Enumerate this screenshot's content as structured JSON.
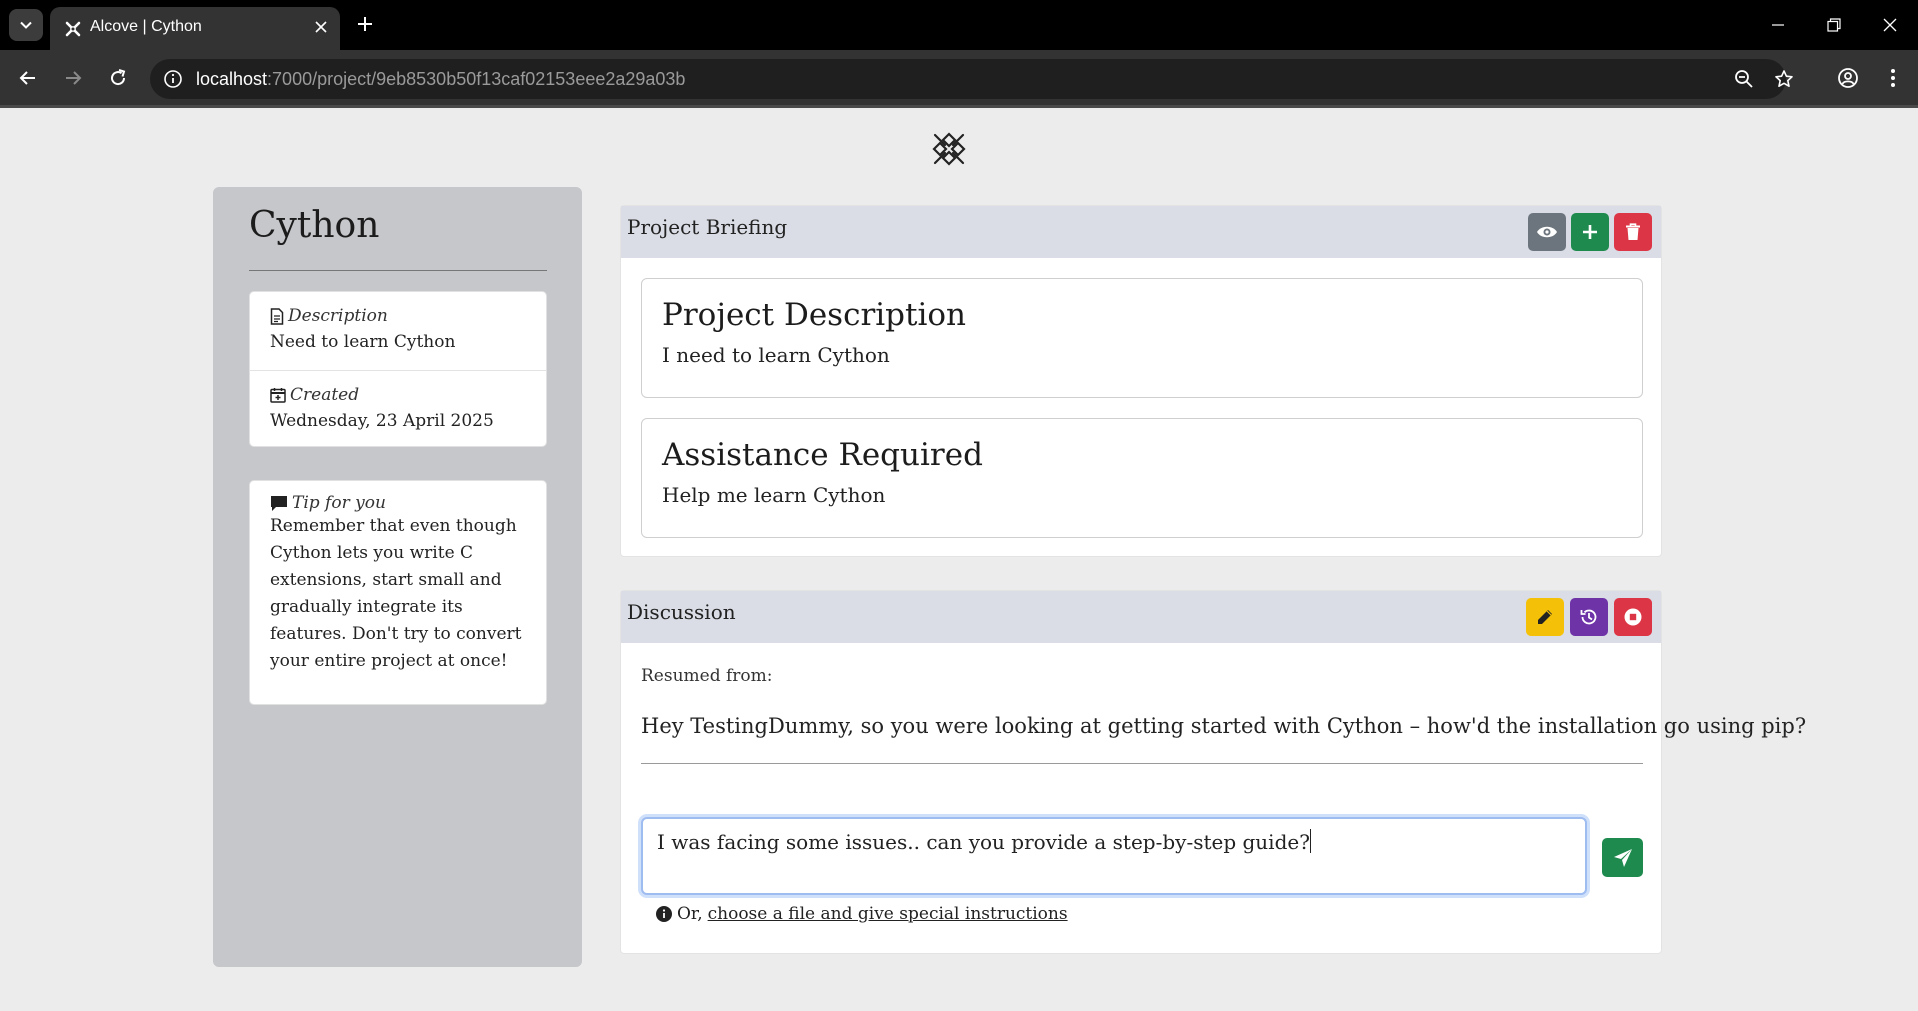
{
  "browser": {
    "tab_title": "Alcove | Cython",
    "url_host": "localhost",
    "url_path": ":7000/project/9eb8530b50f13caf02153eee2a29a03b"
  },
  "sidebar": {
    "title": "Cython",
    "description_label": "Description",
    "description_value": "Need to learn Cython",
    "created_label": "Created",
    "created_value": "Wednesday, 23 April 2025",
    "tip_label": "Tip for you",
    "tip_text": "Remember that even though Cython lets you write C extensions, start small and gradually integrate its features. Don't try to convert your entire project at once!"
  },
  "briefing": {
    "title": "Project Briefing",
    "cards": [
      {
        "title": "Project Description",
        "text": "I need to learn Cython"
      },
      {
        "title": "Assistance Required",
        "text": "Help me learn Cython"
      }
    ]
  },
  "discussion": {
    "title": "Discussion",
    "resumed_label": "Resumed from:",
    "message": "Hey TestingDummy, so you were looking at getting started with Cython – how'd the installation go using pip?",
    "input_value": "I was facing some issues.. can you provide a step-by-step guide?",
    "hint_prefix": "Or,",
    "hint_link": "choose a file and give special instructions"
  },
  "colors": {
    "view_button": "#6c757d",
    "add_button": "#1e8a4e",
    "delete_button": "#dc3545",
    "edit_button": "#f5c108",
    "history_button": "#6f33a8",
    "stop_button": "#dc3545",
    "send_button": "#1e8a4e"
  },
  "icons": [
    "chevron-down-icon",
    "alcove-logo-icon",
    "close-icon",
    "plus-icon",
    "minimize-icon",
    "restore-icon",
    "back-arrow-icon",
    "forward-arrow-icon",
    "reload-icon",
    "info-icon",
    "zoom-icon",
    "star-icon",
    "profile-icon",
    "menu-icon",
    "document-icon",
    "calendar-plus-icon",
    "chat-icon",
    "eye-icon",
    "trash-icon",
    "pencil-icon",
    "history-icon",
    "stop-icon",
    "send-icon"
  ]
}
